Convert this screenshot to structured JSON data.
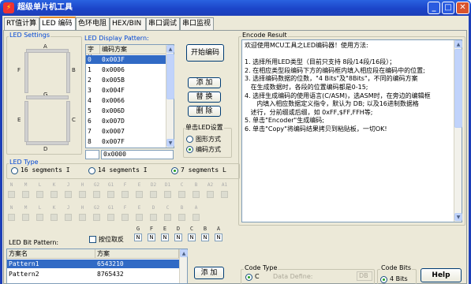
{
  "window": {
    "title": "超级单片机工具",
    "app_icon": "bolt-app-icon",
    "minimize": "_",
    "maximize": "□",
    "close": "✕"
  },
  "tabs": [
    "RT值计算",
    "LED 编码",
    "色环电阻",
    "HEX/BIN",
    "串口调试",
    "串口监视"
  ],
  "active_tab": 1,
  "led_settings": {
    "title": "LED Settings",
    "segment_labels": {
      "A": "A",
      "B": "B",
      "C": "C",
      "D": "D",
      "E": "E",
      "F": "F",
      "G": "G"
    }
  },
  "display_pattern": {
    "title": "LED Display Pattern:",
    "columns": [
      "字符",
      "编码方案"
    ],
    "rows": [
      {
        "char": "0",
        "code": "0x003F",
        "selected": true
      },
      {
        "char": "1",
        "code": "0x0006"
      },
      {
        "char": "2",
        "code": "0x005B"
      },
      {
        "char": "3",
        "code": "0x004F"
      },
      {
        "char": "4",
        "code": "0x0066"
      },
      {
        "char": "5",
        "code": "0x006D"
      },
      {
        "char": "6",
        "code": "0x007D"
      },
      {
        "char": "7",
        "code": "0x0007"
      },
      {
        "char": "8",
        "code": "0x007F"
      }
    ],
    "input_char": "",
    "input_code": "0x0000"
  },
  "buttons": {
    "start": "开始编码",
    "add": "添 加",
    "replace": "替 换",
    "delete": "删 除",
    "add2": "添 加",
    "help": "Help"
  },
  "single_led": {
    "title": "单击LED设置",
    "options": [
      "图形方式",
      "编码方式"
    ],
    "selected": 1
  },
  "led_type": {
    "title": "LED Type",
    "options": [
      "16 segments I",
      "14 segments I",
      "7 segments L"
    ],
    "selected": 2
  },
  "pins_row1": [
    "N",
    "M",
    "L",
    "K",
    "J",
    "H",
    "G2",
    "G1",
    "F",
    "E",
    "D2",
    "D1",
    "C",
    "B",
    "A2",
    "A1"
  ],
  "pins_row2": [
    "N",
    "M",
    "L",
    "K",
    "J",
    "H",
    "G2",
    "G1",
    "F",
    "E",
    "D",
    "C",
    "B",
    "A"
  ],
  "bit_labels": [
    "G",
    "F",
    "E",
    "D",
    "C",
    "B",
    "A"
  ],
  "bit_values": [
    "N",
    "N",
    "N",
    "N",
    "N",
    "N",
    "N"
  ],
  "bit_pattern": {
    "title": "LED Bit Pattern:",
    "checkbox": "按位取反",
    "columns": [
      "方案名",
      "方案"
    ],
    "rows": [
      {
        "name": "Pattern1",
        "value": "6543210",
        "selected": true
      },
      {
        "name": "Pattern2",
        "value": "8765432"
      }
    ]
  },
  "encode_result": {
    "title": "Encode Result",
    "lines": [
      "欢迎使用MCU工具之LED编码器！使用方法:",
      "",
      "1. 选择所用LED类型（目前只支持 8段/14段/16段）；",
      "2. 在相应类型段编码下方的编码框内填入相应段在编码中的位置;",
      "3. 选择编码数据的位数，\"4 Bits\"及\"8Bits\"，不同的编码方案",
      "   在生成数据时，各段的位置编码都是0-15;",
      "4. 选择生成编码的使用语言(C/ASM)，选ASM时，在旁边的编辑框",
      "      内填入相应数据定义指令，默认为 DB; 以及16进制数据格",
      "   述行，分前缀或后缀，如 0xFF,$FF,FFH等;",
      "5. 单击\"Encoder\"生成编码;",
      "6. 单击\"Copy\"将编码结果拷贝到粘贴板，一切OK!"
    ]
  },
  "code_type": {
    "title": "Code Type",
    "options": [
      "C"
    ],
    "selected": 0,
    "data_define_label": "Data Define:",
    "data_define_value": "DB"
  },
  "code_bits": {
    "title": "Code Bits",
    "options": [
      "4 Bits"
    ],
    "selected": 0
  },
  "colors": {
    "title_bar": "#1b45c9",
    "selection": "#316ac5",
    "label_blue": "#0046d5"
  }
}
